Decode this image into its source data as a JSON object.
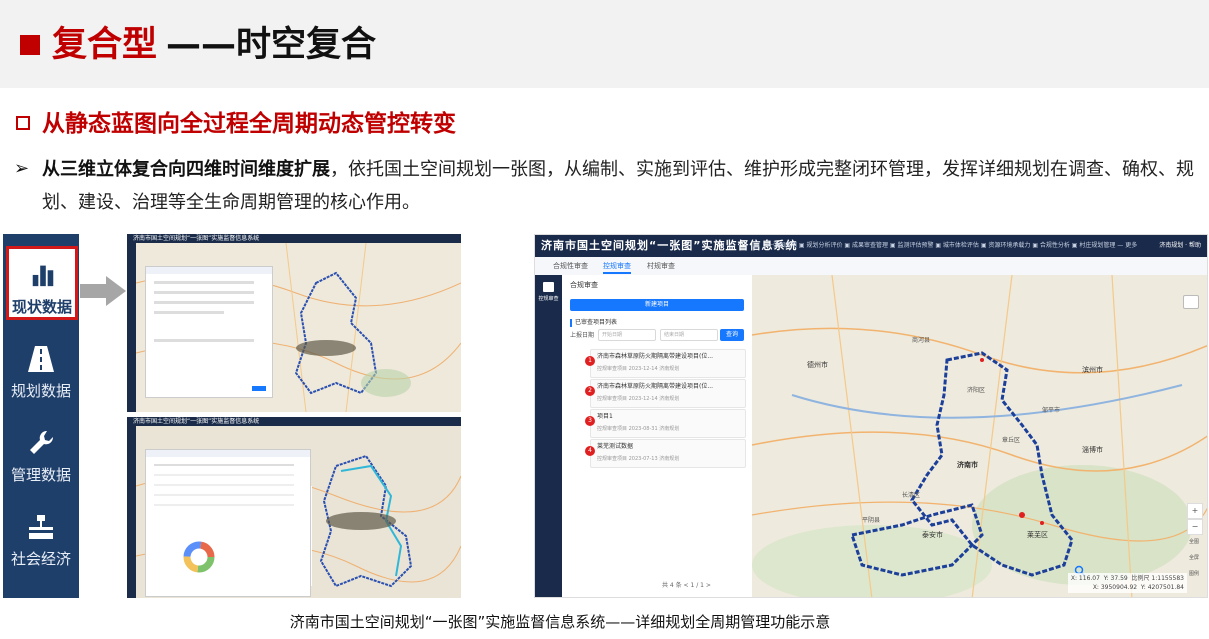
{
  "slide": {
    "title_main": "复合型",
    "title_rest": "——时空复合",
    "subheading": "从静态蓝图向全过程全周期动态管控转变",
    "bullet": {
      "marker": "➢",
      "bold": "从三维立体复合向四维时间维度扩展",
      "text": "，依托国土空间规划一张图，从编制、实施到评估、维护形成完整闭环管理，发挥详细规划在调查、确权、规划、建设、治理等全生命周期管理的核心作用。"
    },
    "caption": "济南市国土空间规划“一张图”实施监督信息系统——详细规划全周期管理功能示意",
    "colors": {
      "accent": "#c00000",
      "sidebar": "#1f3f6b",
      "app_header": "#1a2a4a",
      "primary_blue": "#1677ff"
    }
  },
  "sidebar": {
    "items": [
      {
        "label": "现状数据",
        "icon": "bar-chart-icon",
        "active": true
      },
      {
        "label": "规划数据",
        "icon": "road-icon",
        "active": false
      },
      {
        "label": "管理数据",
        "icon": "wrench-icon",
        "active": false
      },
      {
        "label": "社会经济",
        "icon": "org-chart-icon",
        "active": false
      }
    ]
  },
  "thumbnails": {
    "top_title": "济南市国土空间规划“一张图”实施监督信息系统",
    "bottom_title": "济南市国土空间规划“一张图”实施监督信息系统"
  },
  "app": {
    "title": "济南市国土空间规划“一张图”实施监督信息系统",
    "menu": "一张图应用 ▣ 规划分析评价 ▣ 成果审查管理 ▣ 监测评估预警 ▣ 城市体检评估 ▣ 资源环境承载力 ▣ 合规性分析 ▣ 村庄规划管理 — 更多",
    "user": "济南规划 · 帮助",
    "tabs": [
      "合规性审查",
      "控规审查",
      "村规审查"
    ],
    "active_tab": 1,
    "rail_label": "控规审查",
    "panel": {
      "title": "合规审查",
      "new_button": "新建项目",
      "list_title": "已审查项目列表",
      "date_label": "上报日期",
      "date_start_placeholder": "开始日期",
      "date_end_placeholder": "结束日期",
      "search_button": "查询",
      "projects": [
        {
          "no": "1",
          "name": "济南市森林草原防火期隔离带建设项目(位...",
          "meta": "控规审查项目   2023-12-14   济南规划"
        },
        {
          "no": "2",
          "name": "济南市森林草原防火期隔离带建设项目(位...",
          "meta": "控规审查项目   2023-12-14   济南规划"
        },
        {
          "no": "3",
          "name": "项目1",
          "meta": "控规审查项目   2023-08-31   济南规划"
        },
        {
          "no": "4",
          "name": "莱芜测试数据",
          "meta": "控规审查项目   2023-07-13   济南规划"
        }
      ],
      "pager": "共 4 条   <   1   / 1   >"
    },
    "map": {
      "coords": "X: 116.07  Y: 37.59  比例尺 1:1155583\nX: 3950904.92  Y: 4207501.84",
      "zoom_in": "+",
      "zoom_out": "−",
      "tools": [
        "全图",
        "全屏",
        "图例"
      ],
      "labels": [
        "德州市",
        "滨州市",
        "济南市",
        "淄博市",
        "泰安市",
        "莱芜区",
        "章丘区",
        "邹平市",
        "济阳区",
        "长清区",
        "平阴县",
        "商河县"
      ]
    }
  }
}
